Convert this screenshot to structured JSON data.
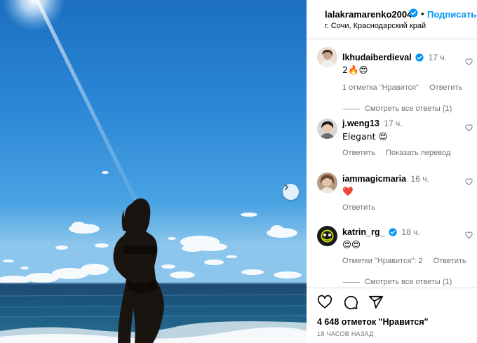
{
  "post": {
    "username": "lalakramarenko2004",
    "separator": "•",
    "follow_label": "Подписаться",
    "location": "г. Сочи, Краснодарский край"
  },
  "comments": [
    {
      "username": "lkhudaiberdieval",
      "verified": true,
      "time": "17 ч.",
      "text": "2🔥😍",
      "likes_label": "1 отметка \"Нравится\"",
      "reply_label": "Ответить",
      "view_replies": "Смотреть все ответы (1)"
    },
    {
      "username": "j.weng13",
      "time": "17 ч.",
      "text": "Elegant 😍",
      "reply_label": "Ответить",
      "translate_label": "Показать перевод"
    },
    {
      "username": "iammagicmaria",
      "time": "16 ч.",
      "text": "❤️",
      "reply_label": "Ответить"
    },
    {
      "username": "katrin_rg_",
      "verified": true,
      "time": "18 ч.",
      "text": "😍😍",
      "likes_label": "Отметки \"Нравится\": 2",
      "reply_label": "Ответить",
      "view_replies": "Смотреть все ответы (1)"
    }
  ],
  "footer": {
    "likes": "4 648 отметок \"Нравится\"",
    "time_ago": "18 ЧАСОВ НАЗАД"
  },
  "icons": {
    "like": "heart-icon",
    "comment": "comment-icon",
    "share": "share-icon",
    "next": "chevron-right-icon",
    "verified": "verified-badge-icon"
  },
  "colors": {
    "accent": "#0095f6",
    "verified": "#0095f6",
    "muted": "#737373",
    "heart_red": "#ed4956"
  }
}
